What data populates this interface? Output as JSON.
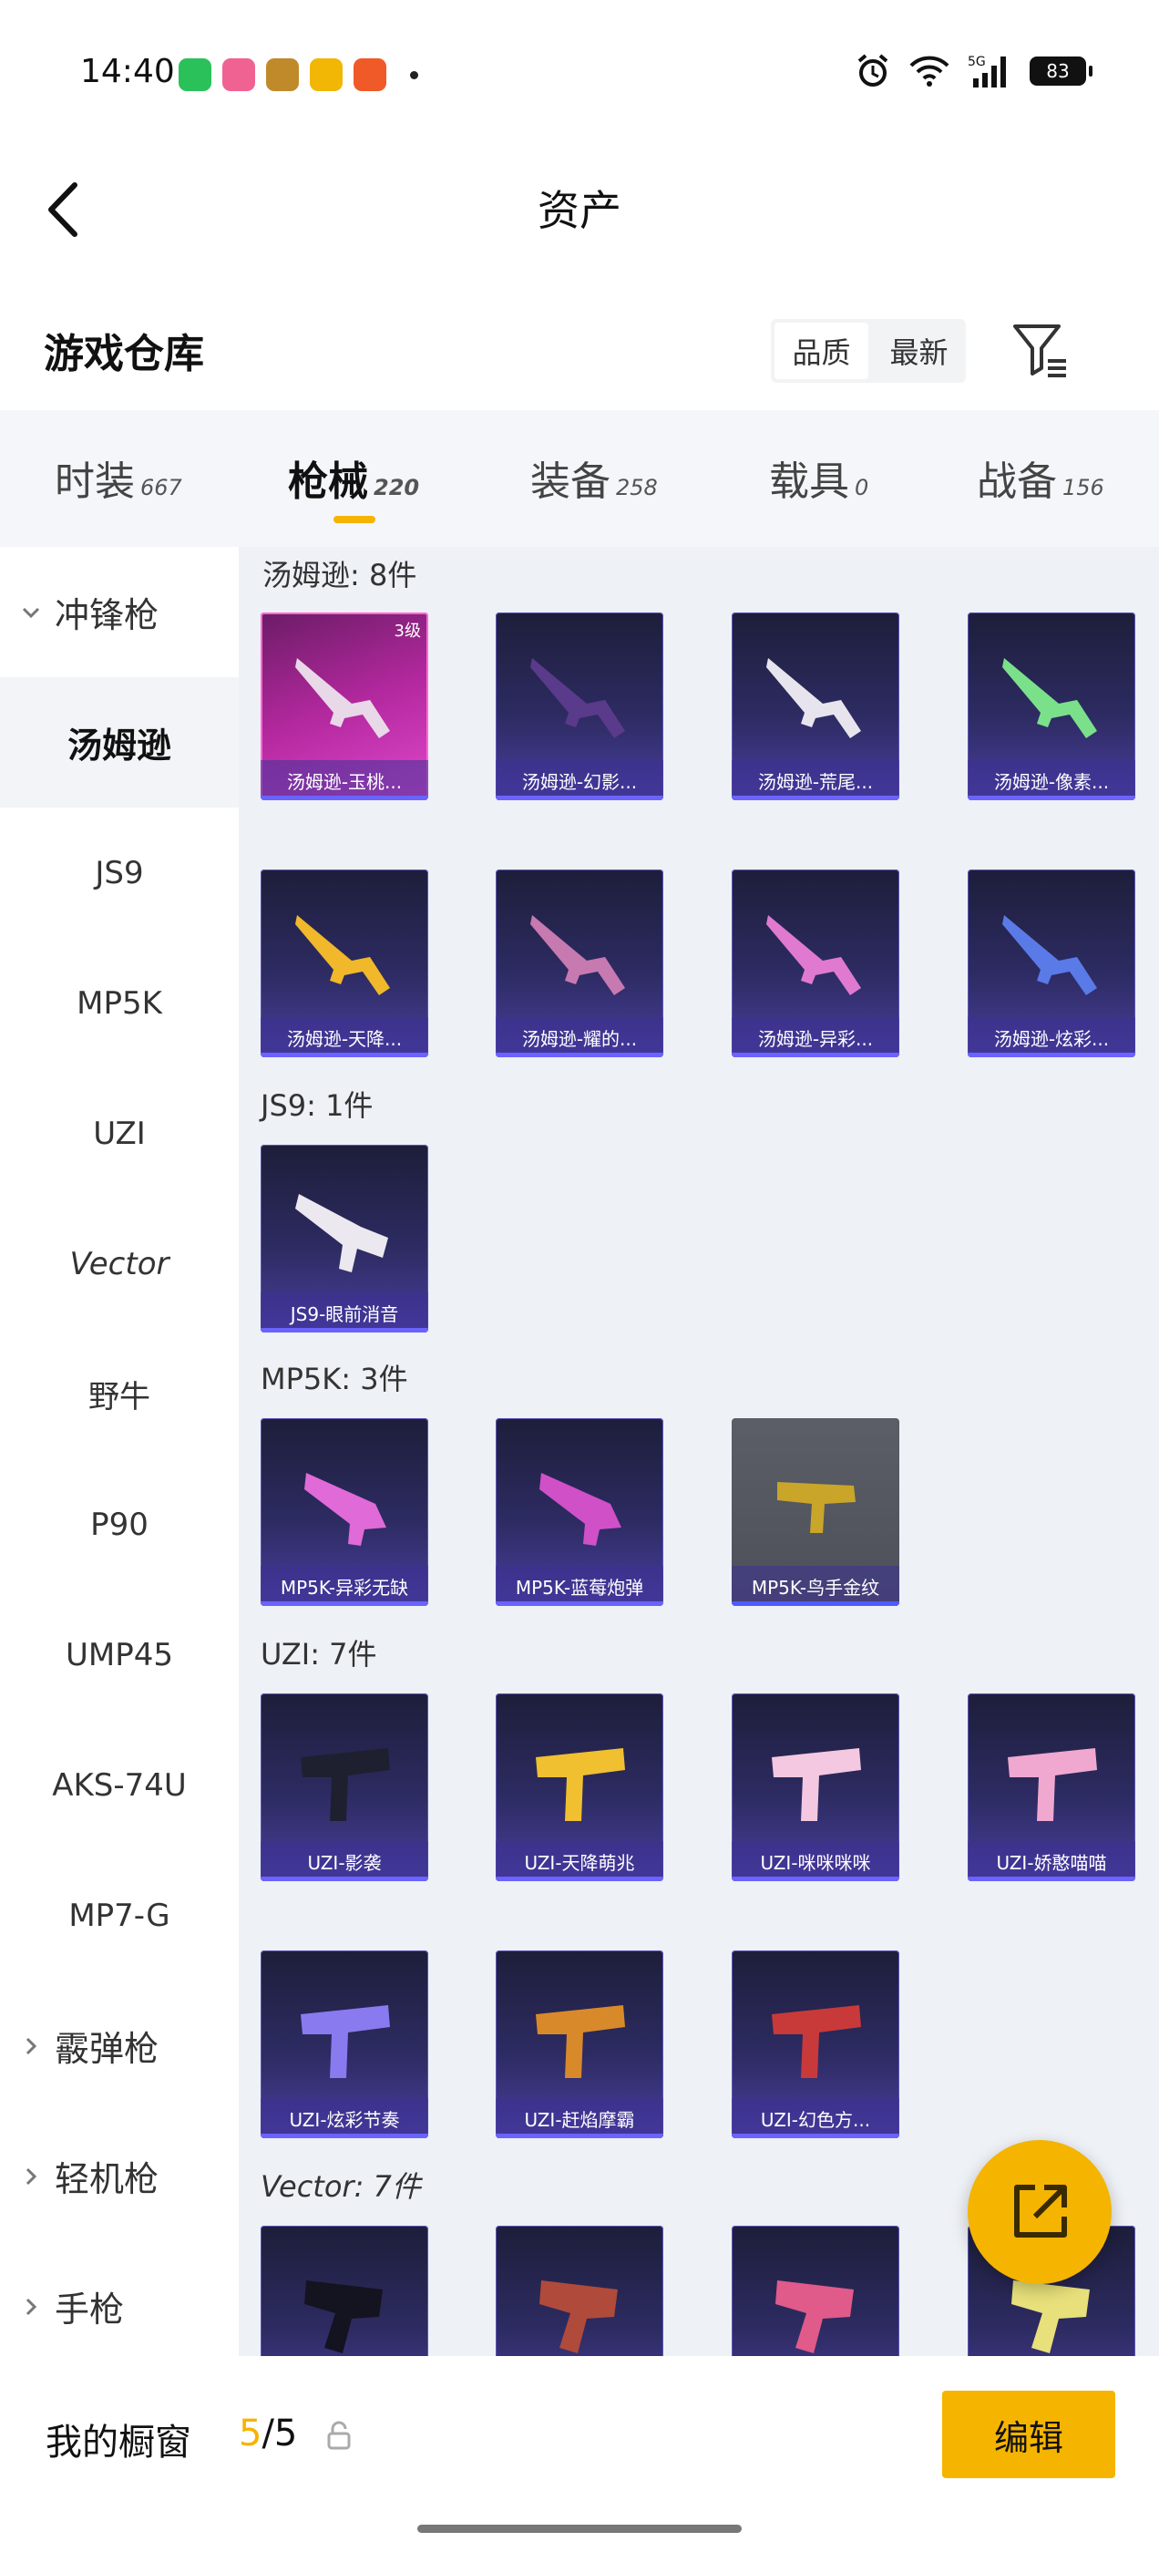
{
  "status_bar": {
    "time": "14:40",
    "battery": "83",
    "network": "5G"
  },
  "header": {
    "title": "资产"
  },
  "warehouse": {
    "title": "游戏仓库",
    "sort_options": [
      "品质",
      "最新"
    ],
    "sort_selected": "品质"
  },
  "tabs": [
    {
      "label": "时装",
      "count": "667"
    },
    {
      "label": "枪械",
      "count": "220",
      "active": true
    },
    {
      "label": "装备",
      "count": "258"
    },
    {
      "label": "载具",
      "count": "0"
    },
    {
      "label": "战备",
      "count": "156"
    }
  ],
  "sidebar": {
    "items": [
      {
        "label": "冲锋枪",
        "type": "group",
        "expanded": true
      },
      {
        "label": "汤姆逊",
        "selected": true
      },
      {
        "label": "JS9"
      },
      {
        "label": "MP5K"
      },
      {
        "label": "UZI"
      },
      {
        "label": "Vector"
      },
      {
        "label": "野牛"
      },
      {
        "label": "P90"
      },
      {
        "label": "UMP45"
      },
      {
        "label": "AKS-74U"
      },
      {
        "label": "MP7-G"
      },
      {
        "label": "霰弹枪",
        "type": "group"
      },
      {
        "label": "轻机枪",
        "type": "group"
      },
      {
        "label": "手枪",
        "type": "group"
      }
    ]
  },
  "sections": [
    {
      "title": "汤姆逊: 8件",
      "items": [
        {
          "label": "汤姆逊-玉桃...",
          "level": "3级",
          "style": "pink"
        },
        {
          "label": "汤姆逊-幻影..."
        },
        {
          "label": "汤姆逊-荒尾..."
        },
        {
          "label": "汤姆逊-像素..."
        },
        {
          "label": "汤姆逊-天降..."
        },
        {
          "label": "汤姆逊-耀的..."
        },
        {
          "label": "汤姆逊-异彩..."
        },
        {
          "label": "汤姆逊-炫彩..."
        }
      ]
    },
    {
      "title": "JS9: 1件",
      "items": [
        {
          "label": "JS9-眼前消音"
        }
      ]
    },
    {
      "title": "MP5K: 3件",
      "items": [
        {
          "label": "MP5K-异彩无缺"
        },
        {
          "label": "MP5K-蓝莓炮弹"
        },
        {
          "label": "MP5K-鸟手金纹",
          "style": "gray"
        }
      ]
    },
    {
      "title": "UZI: 7件",
      "items": [
        {
          "label": "UZI-影袭"
        },
        {
          "label": "UZI-天降萌兆"
        },
        {
          "label": "UZI-咪咪咪咪"
        },
        {
          "label": "UZI-娇憨喵喵"
        },
        {
          "label": "UZI-炫彩节奏"
        },
        {
          "label": "UZI-赶焰摩霸"
        },
        {
          "label": "UZI-幻色方..."
        }
      ]
    },
    {
      "title": "Vector: 7件",
      "items": [
        {
          "label": ""
        },
        {
          "label": ""
        },
        {
          "label": ""
        },
        {
          "label": ""
        }
      ]
    }
  ],
  "showcase": {
    "label": "我的橱窗",
    "count_current": "5",
    "count_total": "/5"
  },
  "actions": {
    "edit": "编辑"
  }
}
